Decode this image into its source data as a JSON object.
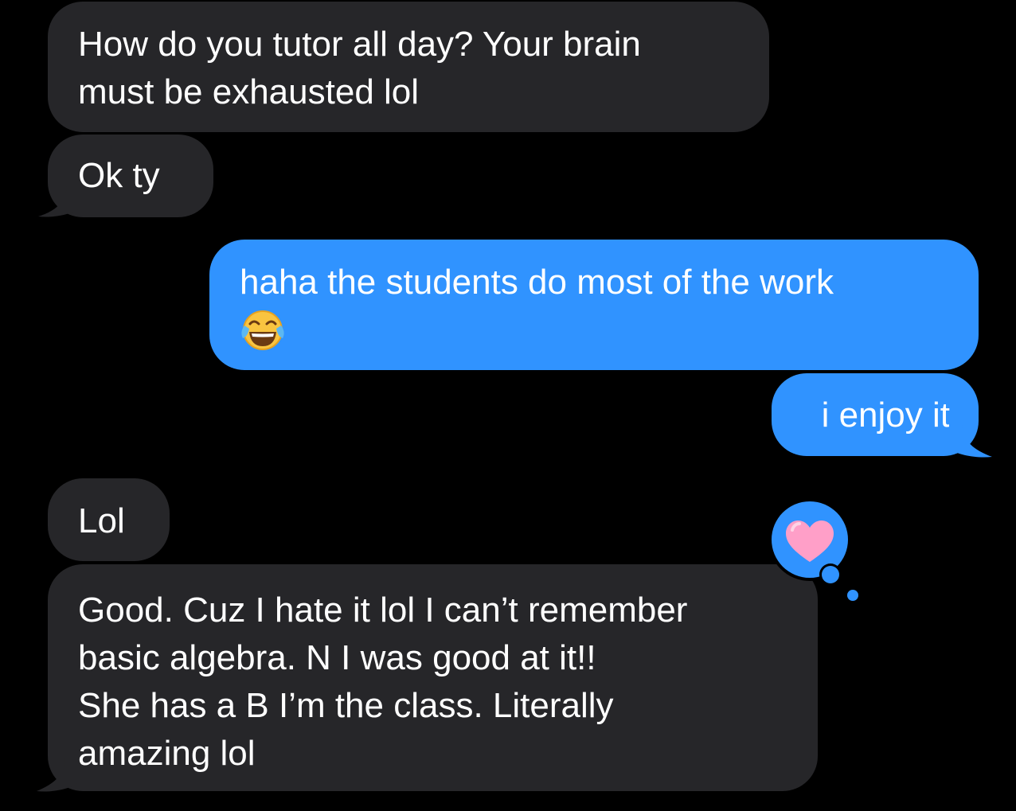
{
  "conversation": {
    "messages": [
      {
        "direction": "incoming",
        "text": "How do you tutor all day? Your brain\nmust be exhausted lol"
      },
      {
        "direction": "incoming",
        "text": "Ok ty"
      },
      {
        "direction": "outgoing",
        "text": "haha the students do most of the work"
      },
      {
        "direction": "outgoing",
        "text": "i enjoy it"
      },
      {
        "direction": "incoming",
        "text": "Lol"
      },
      {
        "direction": "incoming",
        "text": "Good. Cuz I hate it lol I can’t remember\nbasic algebra. N I was good at it!!\nShe has a B I’m the class. Literally\namazing lol"
      }
    ],
    "reaction": {
      "icon": "heart-icon",
      "on_message": 6
    }
  },
  "colors": {
    "background": "#000000",
    "incoming_bubble": "#262629",
    "outgoing_bubble": "#3093FF",
    "text": "#FFFFFF",
    "heart": "#FF9FC8"
  },
  "icons": [
    "tears-of-joy-emoji-icon",
    "heart-icon"
  ]
}
